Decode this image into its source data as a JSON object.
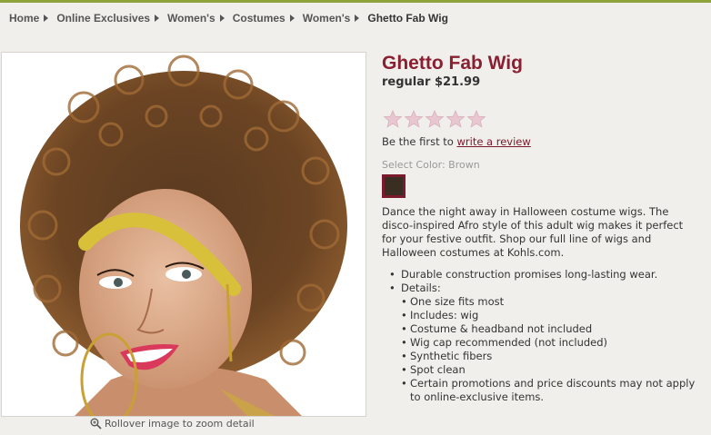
{
  "breadcrumb": [
    "Home",
    "Online Exclusives",
    "Women's",
    "Costumes",
    "Women's",
    "Ghetto Fab Wig"
  ],
  "product": {
    "title": "Ghetto Fab Wig",
    "price": "regular $21.99",
    "rating": 0,
    "rating_max": 5,
    "review_prefix": "Be the first to ",
    "review_link": "write a review",
    "select_color_label": "Select Color: Brown",
    "swatch_color": "#3a2e22",
    "description": "Dance the night away in Halloween costume wigs. The disco-inspired Afro style of this adult wig makes it perfect for your festive outfit. Shop our full line of wigs and Halloween costumes at Kohls.com.",
    "features": [
      "Durable construction promises long-lasting wear.",
      "Details:"
    ],
    "details": [
      "One size fits most",
      "Includes: wig",
      "Costume & headband not included",
      "Wig cap recommended (not included)",
      "Synthetic fibers",
      "Spot clean",
      "Certain promotions and price discounts may not apply to online-exclusive items."
    ]
  },
  "image": {
    "zoom_text": "Rollover image to zoom detail",
    "zoom_icon": "magnifier-icon"
  },
  "colors": {
    "accent": "#8a1f32",
    "link": "#7a1a2c",
    "topbar": "#8fa33c",
    "background": "#f0efeb",
    "star": "#e8c7d0"
  }
}
